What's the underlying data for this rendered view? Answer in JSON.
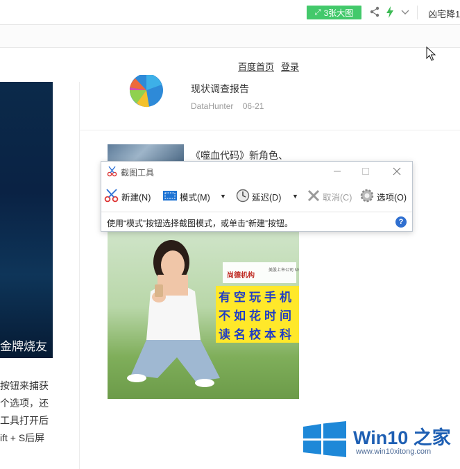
{
  "topbar": {
    "big_image_label": "3张大图",
    "user_name": "凶宅降1"
  },
  "nav": {
    "home": "百度首页",
    "login": "登录"
  },
  "left_panel": {
    "video_caption": "金牌烧友",
    "text_lines": [
      "按钮来捕获",
      "个选项，还",
      "工具打开后",
      "ift + S后屏"
    ]
  },
  "articles": [
    {
      "title": "现状调查报告",
      "author": "DataHunter",
      "date": "06-21"
    },
    {
      "title": "《噬血代码》新角色、"
    }
  ],
  "snipping_tool": {
    "title": "截图工具",
    "buttons": {
      "new": "新建(N)",
      "mode": "模式(M)",
      "delay": "延迟(D)",
      "cancel": "取消(C)",
      "options": "选项(O)"
    },
    "status": "使用“模式”按钮选择截图模式，或单击“新建”按钮。",
    "help": "?"
  },
  "ad": {
    "logo_text": "尚德机构",
    "logo_sub": "美股上市公司 NYSE:STG",
    "slogan": [
      "有空玩手机",
      "不如花时间",
      "读名校本科"
    ]
  },
  "watermark": {
    "brand": "Win10 之家",
    "url": "www.win10xitong.com"
  },
  "colors": {
    "green_button": "#43c96b",
    "help_blue": "#2f6fd0",
    "slogan_blue": "#1f3cc6",
    "slogan_yellow": "#ffe82a",
    "win_blue": "#1e5fb3"
  }
}
